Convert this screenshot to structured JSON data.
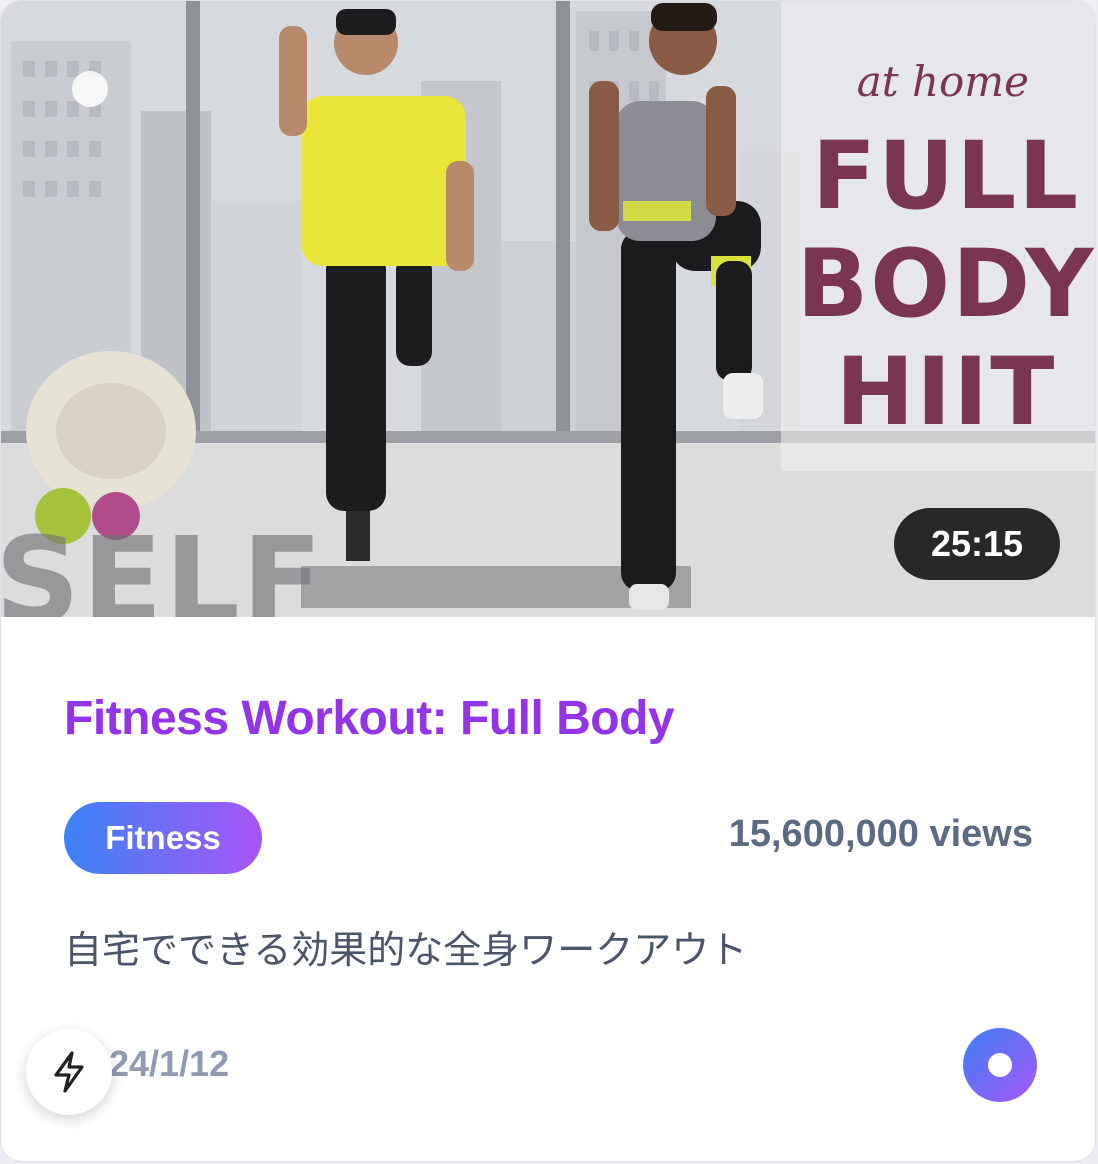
{
  "video": {
    "thumbnail": {
      "overlay_subtitle": "at home",
      "overlay_title_lines": [
        "FULL",
        "BODY",
        "HIIT"
      ],
      "brand_watermark": "SELF",
      "duration": "25:15"
    },
    "title": "Fitness Workout: Full Body",
    "category_tag": "Fitness",
    "views": "15,600,000 views",
    "description": "自宅でできる効果的な全身ワークアウト",
    "date": "24/1/12"
  },
  "icons": {
    "action": "lightning-bolt-icon",
    "record": "record-dot-icon"
  },
  "colors": {
    "title": "#9333ea",
    "tag_gradient_start": "#3b82f6",
    "tag_gradient_end": "#a855f7",
    "overlay_text": "#7a3550",
    "views": "#5d6b82",
    "date": "#8f9bb0"
  }
}
